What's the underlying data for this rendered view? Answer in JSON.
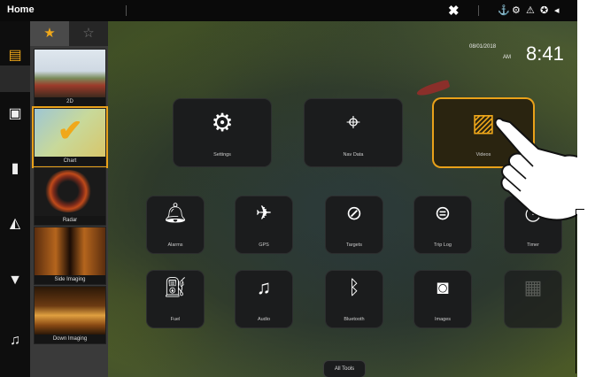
{
  "topbar": {
    "title": "Home",
    "close_glyph": "✖",
    "status_icons": [
      "person-icon",
      "gear-icon",
      "warning-icon",
      "settings-icon",
      "signal-icon"
    ]
  },
  "datetime": {
    "date": "08/01/2018",
    "ampm": "AM",
    "time": "8:41"
  },
  "sidebar": {
    "tabs": [
      "favorites-star-icon",
      "all-star-icon"
    ],
    "views": [
      {
        "label": "2D"
      },
      {
        "label": "Chart"
      },
      {
        "label": "Radar"
      },
      {
        "label": "Side Imaging"
      },
      {
        "label": "Down Imaging"
      }
    ]
  },
  "rail": [
    "views-icon",
    "chart-icon",
    "fish-finder-icon",
    "navigation-icon",
    "motor-icon",
    "music-icon"
  ],
  "tools": {
    "row1": [
      {
        "label": "Settings",
        "icon": "gear-icon"
      },
      {
        "label": "Nav Data",
        "icon": "map-pin-icon"
      },
      {
        "label": "Videos",
        "icon": "folder-image-icon",
        "selected": true
      }
    ],
    "row2": [
      {
        "label": "Alarms",
        "icon": "bell-icon"
      },
      {
        "label": "GPS",
        "icon": "satellite-icon"
      },
      {
        "label": "Targets",
        "icon": "targets-icon"
      },
      {
        "label": "Trip Log",
        "icon": "trip-log-icon"
      },
      {
        "label": "Timer",
        "icon": "timer-icon"
      }
    ],
    "row3": [
      {
        "label": "Fuel",
        "icon": "fuel-icon"
      },
      {
        "label": "Audio",
        "icon": "music-note-icon"
      },
      {
        "label": "Bluetooth",
        "icon": "bluetooth-icon"
      },
      {
        "label": "Images",
        "icon": "camera-icon"
      },
      {
        "label": "",
        "icon": "chart-window-icon"
      }
    ]
  },
  "all_tools_label": "All Tools"
}
